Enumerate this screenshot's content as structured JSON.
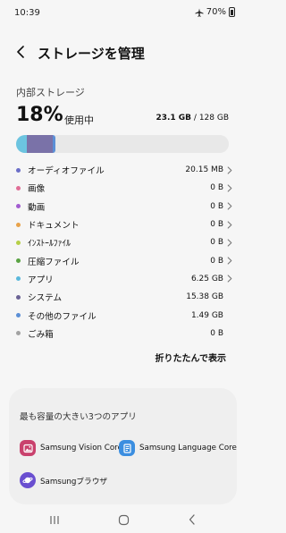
{
  "status_bar": {
    "time": "10:39",
    "battery": "70%"
  },
  "header": {
    "title": "ストレージを管理"
  },
  "storage": {
    "section_label": "内部ストレージ",
    "percent": "18%",
    "in_use_label": "使用中",
    "used": "23.1 GB",
    "separator": " / ",
    "total": "128 GB",
    "usage_fraction": 0.18
  },
  "categories": [
    {
      "name": "オーディオファイル",
      "size": "20.15 MB",
      "color": "#6b6ec8",
      "chevron": true
    },
    {
      "name": "画像",
      "size": "0 B",
      "color": "#e06d96",
      "chevron": true
    },
    {
      "name": "動画",
      "size": "0 B",
      "color": "#a25cd0",
      "chevron": true
    },
    {
      "name": "ドキュメント",
      "size": "0 B",
      "color": "#e8a24a",
      "chevron": true
    },
    {
      "name": "ｲﾝｽﾄｰﾙﾌｧｲﾙ",
      "size": "0 B",
      "color": "#b6cf48",
      "chevron": true
    },
    {
      "name": "圧縮ファイル",
      "size": "0 B",
      "color": "#5aa344",
      "chevron": true
    },
    {
      "name": "アプリ",
      "size": "6.25 GB",
      "color": "#5ab8dc",
      "chevron": true
    },
    {
      "name": "システム",
      "size": "15.38 GB",
      "color": "#6a6294",
      "chevron": false
    },
    {
      "name": "その他のファイル",
      "size": "1.49 GB",
      "color": "#5b8fd6",
      "chevron": false
    },
    {
      "name": "ごみ箱",
      "size": "0 B",
      "color": "#a3a3a3",
      "chevron": false
    }
  ],
  "bar_segments": [
    {
      "name": "アプリ",
      "fraction": 0.049,
      "color": "#6cc4e0"
    },
    {
      "name": "システム",
      "fraction": 0.12,
      "color": "#7a72a8"
    },
    {
      "name": "その他のファイル",
      "fraction": 0.012,
      "color": "#5b8fd6"
    }
  ],
  "collapse_button": "折りたたんで表示",
  "top_apps": {
    "title": "最も容量の大きい3つのアプリ",
    "apps": [
      {
        "name": "Samsung Vision Core",
        "icon": "gallery-icon",
        "color": "#c9416d"
      },
      {
        "name": "Samsung Language Core",
        "icon": "document-icon",
        "color": "#3b8ee0"
      },
      {
        "name": "Samsungブラウザ",
        "icon": "planet-icon",
        "color": "#6a4fd0"
      }
    ]
  },
  "navbar": {
    "recents": "recents-icon",
    "home": "home-icon",
    "back": "back-icon"
  }
}
